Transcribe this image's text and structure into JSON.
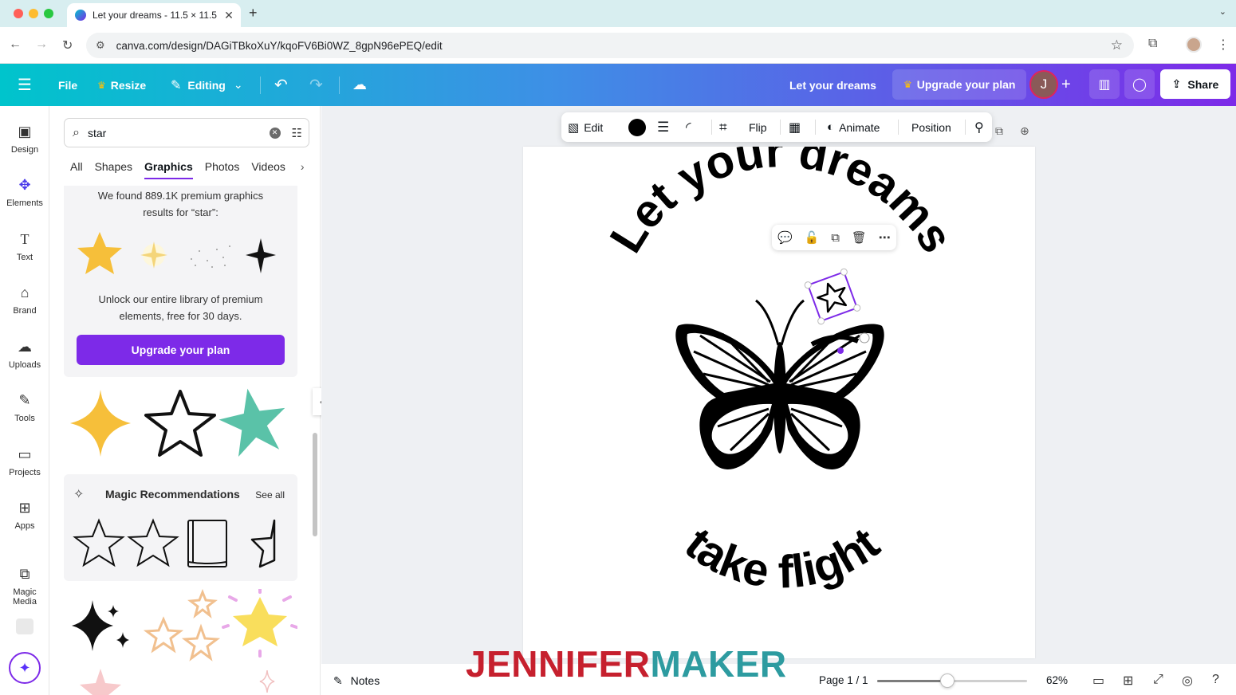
{
  "browser": {
    "tab_title": "Let your dreams - 11.5 × 11.5",
    "url": "canva.com/design/DAGiTBkoXuY/kqoFV6Bi0WZ_8gpN96ePEQ/edit"
  },
  "header": {
    "file": "File",
    "resize": "Resize",
    "editing": "Editing",
    "doc_title": "Let your dreams",
    "upgrade": "Upgrade your plan",
    "avatar_letter": "J",
    "share": "Share"
  },
  "rail": {
    "items": [
      {
        "label": "Design",
        "icon": "design-icon"
      },
      {
        "label": "Elements",
        "icon": "elements-icon"
      },
      {
        "label": "Text",
        "icon": "text-icon"
      },
      {
        "label": "Brand",
        "icon": "brand-icon"
      },
      {
        "label": "Uploads",
        "icon": "uploads-icon"
      },
      {
        "label": "Tools",
        "icon": "tools-icon"
      },
      {
        "label": "Projects",
        "icon": "projects-icon"
      },
      {
        "label": "Apps",
        "icon": "apps-icon"
      },
      {
        "label": "Magic Media",
        "icon": "magic-media-icon"
      }
    ]
  },
  "panel": {
    "search_value": "star",
    "tabs": [
      "All",
      "Shapes",
      "Graphics",
      "Photos",
      "Videos"
    ],
    "active_tab": "Graphics",
    "found_line1": "We found 889.1K premium graphics",
    "found_line2": "results for “star”:",
    "unlock_line1": "Unlock our entire library of premium",
    "unlock_line2": "elements, free for 30 days.",
    "upgrade_btn": "Upgrade your plan",
    "magic_title": "Magic Recommendations",
    "see_all": "See all"
  },
  "toolbar": {
    "edit": "Edit",
    "flip": "Flip",
    "animate": "Animate",
    "position": "Position"
  },
  "canvas": {
    "top_text": "Let your dreams",
    "bottom_text": "take flight"
  },
  "bottom": {
    "notes": "Notes",
    "page_indicator": "Page 1 / 1",
    "zoom": "62%",
    "zoom_fraction": 0.47,
    "watermark_a": "JENNIFER",
    "watermark_b": "MAKER"
  },
  "colors": {
    "accent": "#7d2ae8",
    "gold_star": "#f6bf3a",
    "teal_star": "#5ac2a8",
    "watermark_red": "#c6202e",
    "watermark_teal": "#2d9ba0"
  }
}
